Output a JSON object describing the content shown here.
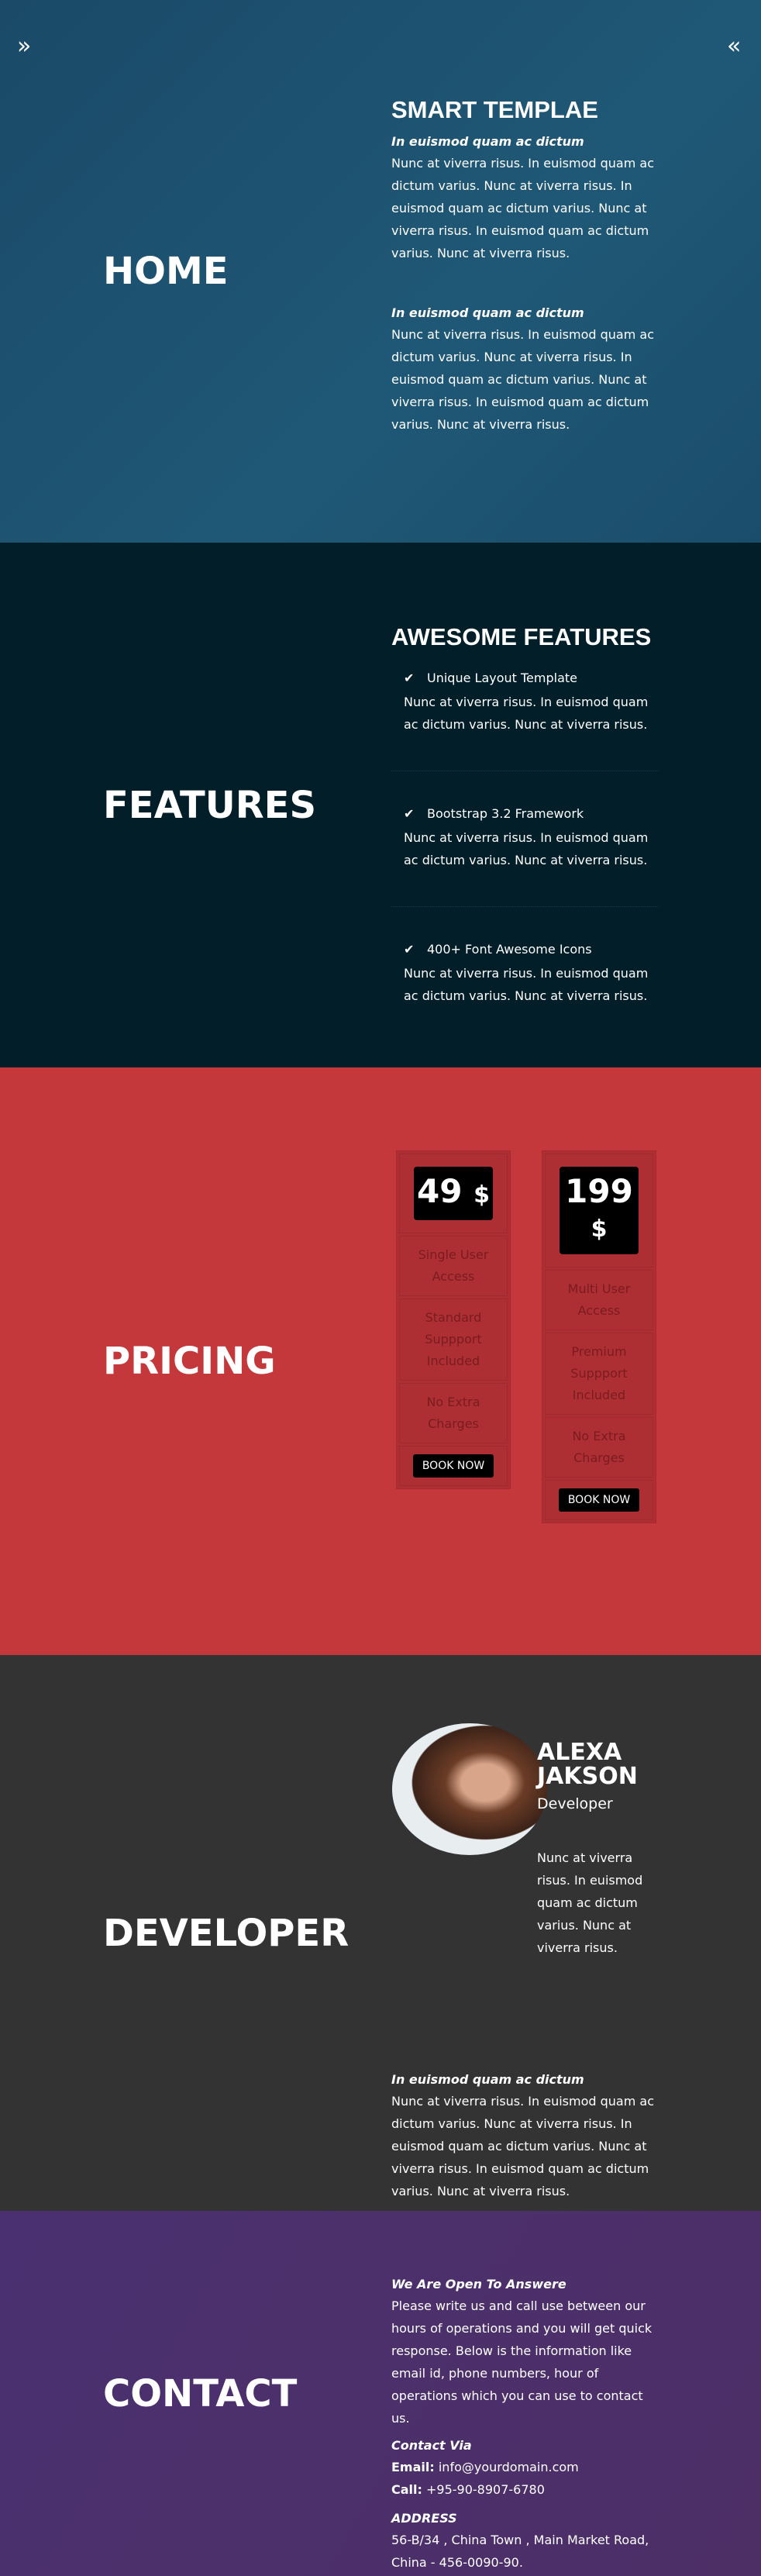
{
  "home": {
    "heading": "HOME",
    "title": "SMART TEMPLAE",
    "blocks": [
      {
        "subtitle": "In euismod quam ac dictum",
        "text": "Nunc at viverra risus. In euismod quam ac dictum varius. Nunc at viverra risus. In euismod quam ac dictum varius. Nunc at viverra risus. In euismod quam ac dictum varius. Nunc at viverra risus."
      },
      {
        "subtitle": "In euismod quam ac dictum",
        "text": "Nunc at viverra risus. In euismod quam ac dictum varius. Nunc at viverra risus. In euismod quam ac dictum varius. Nunc at viverra risus. In euismod quam ac dictum varius. Nunc at viverra risus."
      }
    ],
    "nav_left": "»",
    "nav_right": "«"
  },
  "features": {
    "heading": "FEATURES",
    "title": "AWESOME FEATURES",
    "check": "✔",
    "items": [
      {
        "title": "Unique Layout Template",
        "text": "Nunc at viverra risus. In euismod quam ac dictum varius. Nunc at viverra risus."
      },
      {
        "title": "Bootstrap 3.2 Framework",
        "text": "Nunc at viverra risus. In euismod quam ac dictum varius. Nunc at viverra risus."
      },
      {
        "title": "400+ Font Awesome Icons",
        "text": "Nunc at viverra risus. In euismod quam ac dictum varius. Nunc at viverra risus."
      }
    ]
  },
  "pricing": {
    "heading": "PRICING",
    "plans": [
      {
        "price": "49",
        "currency": "$",
        "features": [
          "Single User Access",
          "Standard Suppport Included",
          "No Extra Charges"
        ],
        "button": "BOOK NOW"
      },
      {
        "price": "199",
        "currency": "$",
        "features": [
          "Multi User Access",
          "Premium Suppport Included",
          "No Extra Charges"
        ],
        "button": "BOOK NOW"
      }
    ]
  },
  "developer": {
    "heading": "DEVELOPER",
    "name": "ALEXA JAKSON",
    "role": "Developer",
    "bio": "Nunc at viverra risus. In euismod quam ac dictum varius. Nunc at viverra risus.",
    "subtitle": "In euismod quam ac dictum",
    "text": "Nunc at viverra risus. In euismod quam ac dictum varius. Nunc at viverra risus. In euismod quam ac dictum varius. Nunc at viverra risus. In euismod quam ac dictum varius. Nunc at viverra risus."
  },
  "contact": {
    "heading": "CONTACT",
    "open_title": "We Are Open To Answere",
    "open_text": "Please write us and call use between our hours of operations and you will get quick response. Below is the information like email id, phone numbers, hour of operations which you can use to contact us.",
    "via_title": "Contact Via",
    "email_label": "Email:",
    "email": "info@yourdomain.com",
    "call_label": "Call:",
    "phone": "+95-90-8907-6780",
    "address_title": "ADDRESS",
    "address": "56-B/34 , China Town , Main Market Road, China - 456-0090-90."
  },
  "colors": {
    "home": "#1d5070",
    "features": "#011e29",
    "pricing": "#c4373b",
    "developer": "#333333",
    "contact": "#4b3169"
  }
}
